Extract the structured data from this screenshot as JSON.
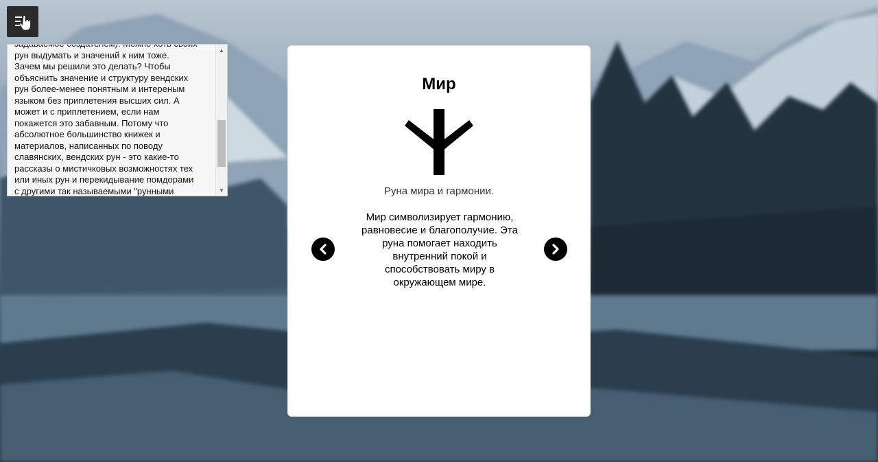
{
  "menu": {
    "icon": "menu-hand-icon"
  },
  "text_panel": {
    "lines": [
      "задаваемое создателем). Можно хоть своих",
      "рун выдумать и значений к ним тоже.",
      "Зачем мы решили это делать? Чтобы",
      "объяснить значение и структуру вендских",
      "рун более-менее понятным и интереным",
      "языком без приплетения высших сил. А",
      "может и с приплетением, если нам",
      "покажется это забавным. Потому что",
      "абсолютное большинство книжек и",
      "материалов, написанных по поводу",
      "славянских, вендских рун - это какие-то",
      "рассказы о мистичковых возможностях тех",
      "или иных рун и перекидывание помдорами",
      "с другими так называемыми \"рунными"
    ]
  },
  "card": {
    "title": "Мир",
    "subtitle": "Руна мира и гармонии.",
    "description": "Мир символизирует гармонию, равновесие и благополучие. Эта руна помогает находить внутренний покой и способствовать миру в окружающем мире.",
    "prev_icon": "chevron-left-icon",
    "next_icon": "chevron-right-icon"
  },
  "colors": {
    "card_bg": "#ffffff",
    "menu_bg": "#2b2b2b",
    "nav_bg": "#000000"
  }
}
